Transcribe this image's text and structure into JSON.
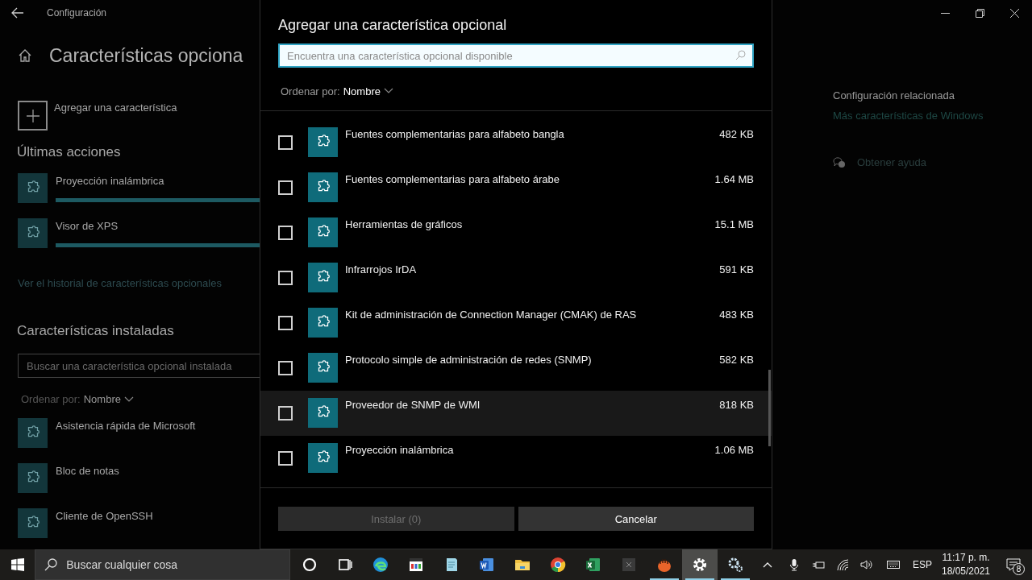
{
  "window": {
    "title": "Configuración"
  },
  "page": {
    "title": "Características opciona",
    "add_feature": "Agregar una característica",
    "recent_heading": "Últimas acciones",
    "recent": [
      {
        "name": "Proyección inalámbrica",
        "level": 1
      },
      {
        "name": "Visor de XPS",
        "level": 1
      }
    ],
    "history_link": "Ver el historial de características opcionales",
    "installed_heading": "Características instaladas",
    "installed_search": {
      "placeholder": "Buscar una característica opcional instalada"
    },
    "sort": {
      "label": "Ordenar por:",
      "value": "Nombre"
    },
    "installed": [
      "Asistencia rápida de Microsoft",
      "Bloc de notas",
      "Cliente de OpenSSH"
    ]
  },
  "related": {
    "heading": "Configuración relacionada",
    "link": "Más características de Windows",
    "help": "Obtener ayuda"
  },
  "dialog": {
    "title": "Agregar una característica opcional",
    "search": {
      "placeholder": "Encuentra una característica opcional disponible"
    },
    "sort": {
      "label": "Ordenar por:",
      "value": "Nombre"
    },
    "features": [
      {
        "name": "Fuentes complementarias para alfabeto bangla",
        "size": "482 KB",
        "checked": false,
        "hovered": false
      },
      {
        "name": "Fuentes complementarias para alfabeto árabe",
        "size": "1.64 MB",
        "checked": false,
        "hovered": false
      },
      {
        "name": "Herramientas de gráficos",
        "size": "15.1 MB",
        "checked": false,
        "hovered": false
      },
      {
        "name": "Infrarrojos IrDA",
        "size": "591 KB",
        "checked": false,
        "hovered": false
      },
      {
        "name": "Kit de administración de Connection Manager (CMAK) de RAS",
        "size": "483 KB",
        "checked": false,
        "hovered": false
      },
      {
        "name": "Protocolo simple de administración de redes (SNMP)",
        "size": "582 KB",
        "checked": false,
        "hovered": false
      },
      {
        "name": "Proveedor de SNMP de WMI",
        "size": "818 KB",
        "checked": false,
        "hovered": true
      },
      {
        "name": "Proyección inalámbrica",
        "size": "1.06 MB",
        "checked": false,
        "hovered": false
      }
    ],
    "buttons": [
      {
        "label": "Instalar (0)",
        "disabled": true
      },
      {
        "label": "Cancelar",
        "disabled": false
      }
    ]
  },
  "taskbar": {
    "search": {
      "placeholder": "Buscar cualquier cosa"
    },
    "apps": [
      {
        "kind": "cortana",
        "running": false,
        "active": false
      },
      {
        "kind": "taskview",
        "running": false,
        "active": false
      },
      {
        "kind": "edge",
        "running": false,
        "active": false
      },
      {
        "kind": "media",
        "running": false,
        "active": false
      },
      {
        "kind": "notepad",
        "running": false,
        "active": false
      },
      {
        "kind": "word",
        "running": false,
        "active": false
      },
      {
        "kind": "explorer",
        "running": false,
        "active": false
      },
      {
        "kind": "chrome",
        "running": false,
        "active": false
      },
      {
        "kind": "excel",
        "running": false,
        "active": false
      },
      {
        "kind": "dark",
        "running": false,
        "active": false
      },
      {
        "kind": "orange",
        "running": true,
        "active": false
      },
      {
        "kind": "settings",
        "running": true,
        "active": true
      },
      {
        "kind": "gears",
        "running": true,
        "active": false
      }
    ],
    "tray": {
      "language": "ESP",
      "time": "11:17 p. m.",
      "date": "18/05/2021",
      "notifications": "8"
    }
  }
}
